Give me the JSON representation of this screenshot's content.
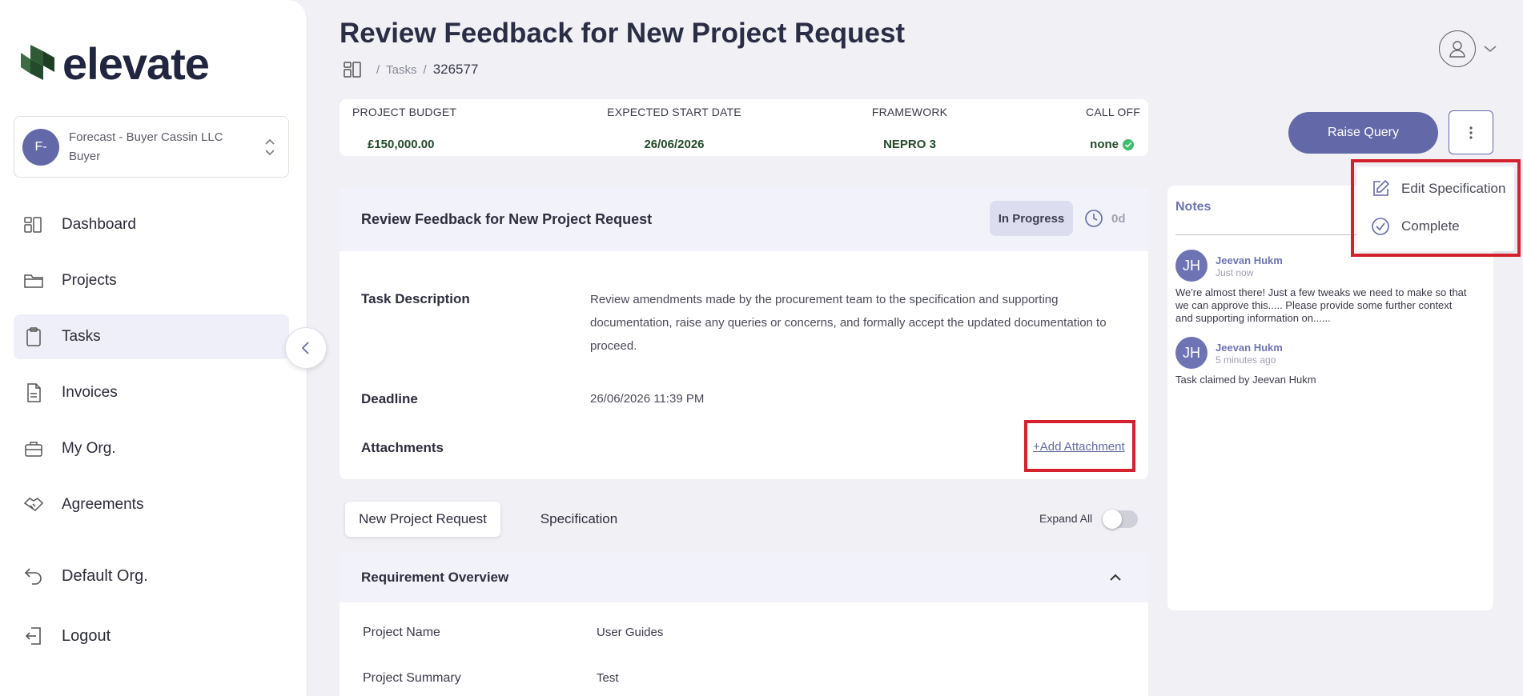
{
  "app": {
    "brand": "elevate",
    "accent": "#6369a8",
    "brand_green": "#234a2c"
  },
  "sidebar": {
    "org": {
      "initials": "F-",
      "name": "Forecast - Buyer Cassin LLC",
      "role": "Buyer"
    },
    "items": [
      {
        "label": "Dashboard",
        "icon": "dashboard-icon"
      },
      {
        "label": "Projects",
        "icon": "folder-icon"
      },
      {
        "label": "Tasks",
        "icon": "clipboard-icon",
        "active": true
      },
      {
        "label": "Invoices",
        "icon": "document-icon"
      },
      {
        "label": "My Org.",
        "icon": "briefcase-icon"
      },
      {
        "label": "Agreements",
        "icon": "handshake-icon"
      }
    ],
    "default_org": "Default Org.",
    "logout": "Logout"
  },
  "header": {
    "title": "Review Feedback for New Project Request",
    "breadcrumb": {
      "section": "Tasks",
      "sep": "/",
      "current": "326577"
    }
  },
  "summary": [
    {
      "label": "PROJECT BUDGET",
      "value": "£150,000.00"
    },
    {
      "label": "EXPECTED START DATE",
      "value": "26/06/2026"
    },
    {
      "label": "FRAMEWORK",
      "value": "NEPRO 3"
    },
    {
      "label": "CALL OFF",
      "value": "none"
    }
  ],
  "actions": {
    "raise_query": "Raise Query",
    "menu": [
      {
        "label": "Edit Specification",
        "icon": "edit-icon"
      },
      {
        "label": "Complete",
        "icon": "check-circle-icon"
      }
    ]
  },
  "task": {
    "title": "Review Feedback for New Project Request",
    "status": "In Progress",
    "elapsed": "0d",
    "description_label": "Task Description",
    "description": "Review amendments made by the procurement team to the specification and supporting documentation, raise any queries or concerns, and formally accept the updated documentation to proceed.",
    "deadline_label": "Deadline",
    "deadline": "26/06/2026 11:39 PM",
    "attachments_label": "Attachments",
    "add_attachment": "+Add Attachment"
  },
  "tabs": [
    {
      "label": "New Project Request",
      "active": true
    },
    {
      "label": "Specification"
    }
  ],
  "expand_all": "Expand All",
  "requirement": {
    "title": "Requirement Overview",
    "rows": [
      {
        "label": "Project Name",
        "value": "User Guides"
      },
      {
        "label": "Project Summary",
        "value": "Test"
      }
    ]
  },
  "notes": {
    "title": "Notes",
    "items": [
      {
        "initials": "JH",
        "author": "Jeevan Hukm",
        "time": "Just now",
        "body": "We're almost there! Just a few tweaks we need to make so that we can approve this..... Please provide some further context and supporting information on......"
      },
      {
        "initials": "JH",
        "author": "Jeevan Hukm",
        "time": "5 minutes ago",
        "body": "Task claimed by Jeevan Hukm"
      }
    ]
  }
}
